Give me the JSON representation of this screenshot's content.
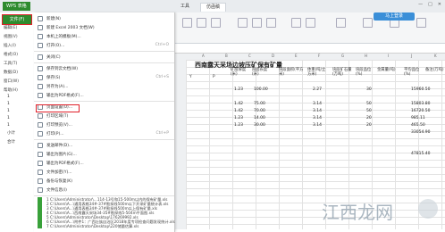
{
  "app": {
    "name": "WPS 表格"
  },
  "window_tabs": [
    "工具",
    "仿函稿"
  ],
  "window_controls": [
    "—",
    "□",
    "✕"
  ],
  "login_label": "马上登录",
  "file_button": "文件(F)",
  "sidebar_items": [
    "编辑(E)",
    "视图(V)",
    "插入(I)",
    "格式(O)",
    "工具(T)",
    "数据(D)",
    "窗口(W)",
    "帮助(H)"
  ],
  "left_row_labels": [
    "1",
    "1",
    "1",
    "1",
    "1",
    "小计",
    "合计"
  ],
  "file_menu": [
    {
      "label": "新建(N)",
      "icon": "new-file-icon",
      "shortcut": ""
    },
    {
      "label": "新建 Excel 2003 文档(W)",
      "icon": "excel-icon",
      "shortcut": ""
    },
    {
      "label": "本机上的模板(M)...",
      "icon": "template-icon",
      "shortcut": ""
    },
    {
      "label": "打开(O)...",
      "icon": "open-folder-icon",
      "shortcut": "Ctrl+O"
    },
    {
      "label": "关闭(C)",
      "icon": "close-file-icon",
      "shortcut": ""
    },
    {
      "label": "保存到云文档(W)",
      "icon": "cloud-save-icon",
      "shortcut": ""
    },
    {
      "label": "保存(S)",
      "icon": "save-icon",
      "shortcut": "Ctrl+S"
    },
    {
      "label": "另存为(A)...",
      "icon": "save-as-icon",
      "shortcut": ""
    },
    {
      "label": "输出为PDF格式(F)...",
      "icon": "pdf-icon",
      "shortcut": ""
    },
    {
      "label": "页面设置(U)...",
      "icon": "page-setup-icon",
      "shortcut": ""
    },
    {
      "label": "打印区域(T)",
      "icon": "print-area-icon",
      "shortcut": ""
    },
    {
      "label": "打印预览(V)...",
      "icon": "print-preview-icon",
      "shortcut": ""
    },
    {
      "label": "打印(P)...",
      "icon": "print-icon",
      "shortcut": "Ctrl+P"
    },
    {
      "label": "发送邮件(D)...",
      "icon": "mail-icon",
      "shortcut": ""
    },
    {
      "label": "输出为图片(G)...",
      "icon": "image-icon",
      "shortcut": ""
    },
    {
      "label": "输出为PDF格式(F)...",
      "icon": "pdf-icon",
      "shortcut": ""
    },
    {
      "label": "文件加密(Y)...",
      "icon": "lock-icon",
      "shortcut": ""
    },
    {
      "label": "备份与恢复(K)",
      "icon": "backup-icon",
      "shortcut": ""
    },
    {
      "label": "文件信息(I)",
      "icon": "info-icon",
      "shortcut": ""
    }
  ],
  "recent_files": [
    "1 C:\\Users\\Administrator\\...114-13号和15-500m以内的保有矿量.xls",
    "2 C:\\Users\\A...\\通用表格34#-37#勘探线500m以下开采矿量统计表.xls",
    "3 C:\\Users\\A...\\通用表格34#-37#勘探线500m以上保有矿量.xls",
    "4 C:\\Users\\A...\\西南露天采场34-35#勘探线5-504m平面图.xls",
    "5 C:\\Users\\Administrator\\Desktop\\176269992.xls",
    "6 C:\\Users\\A...\\附件1：广西壮族自治区2018年度专项检查问题发现统计.xls",
    "7 C:\\Users\\Administrator\\Desktop\\220储量估算.xls"
  ],
  "sheet": {
    "title": "西南露天采场边坡压矿保有矿量",
    "col_letters": [
      "A",
      "B",
      "C",
      "D",
      "E",
      "F",
      "G",
      "H",
      "I",
      "J",
      "K"
    ],
    "headers": [
      "矿层厚度(米)",
      "剖面长度(米)",
      "块段面积(平方米)",
      "体重(吨/立方米)",
      "块段矿石量(万吨)",
      "块段品位(%)",
      "金属量(吨)",
      "平均品位(%)",
      "备注(万吨)"
    ],
    "sub_headers": [
      "Y",
      "P"
    ],
    "rows": [
      [
        "1.23",
        "100.00",
        "2.27",
        "30",
        "15960.50"
      ],
      [
        "1.42",
        "75.00",
        "3.14",
        "50",
        "15803.80"
      ],
      [
        "1.42",
        "70.00",
        "3.14",
        "50",
        "16720.50"
      ],
      [
        "1.23",
        "14.00",
        "3.14",
        "20",
        "985.11"
      ],
      [
        "1.23",
        "30.00",
        "3.14",
        "20",
        "465.50"
      ],
      [
        "",
        "",
        "",
        "",
        "33054.90"
      ],
      [
        "",
        "",
        "",
        "",
        "47815.40"
      ]
    ]
  },
  "watermark": "江西龙网"
}
